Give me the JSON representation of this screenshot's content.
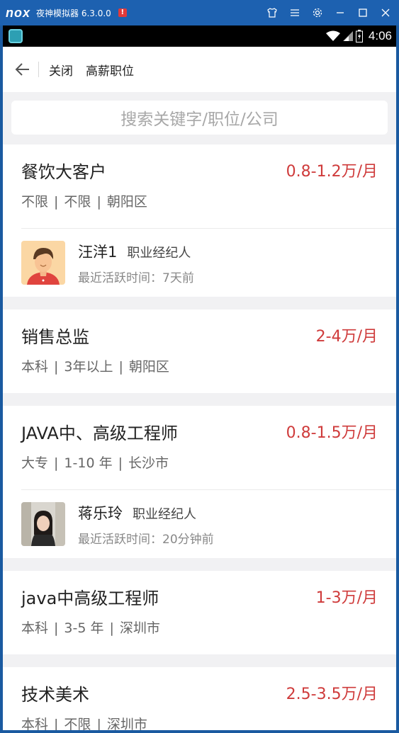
{
  "emulator": {
    "logo": "nox",
    "title": "夜神模拟器 6.3.0.0",
    "alert": "!"
  },
  "status_bar": {
    "time": "4:06"
  },
  "header": {
    "close_label": "关闭",
    "title": "高薪职位"
  },
  "search": {
    "placeholder": "搜索关键字/职位/公司"
  },
  "jobs": [
    {
      "title": "餐饮大客户",
      "salary": "0.8-1.2万/月",
      "education": "不限",
      "experience": "不限",
      "location": "朝阳区",
      "agent": {
        "name": "汪洋1",
        "role": "职业经纪人",
        "active": "最近活跃时间：7天前"
      }
    },
    {
      "title": "销售总监",
      "salary": "2-4万/月",
      "education": "本科",
      "experience": "3年以上",
      "location": "朝阳区"
    },
    {
      "title": "JAVA中、高级工程师",
      "salary": "0.8-1.5万/月",
      "education": "大专",
      "experience": "1-10 年",
      "location": "长沙市",
      "agent": {
        "name": "蒋乐玲",
        "role": "职业经纪人",
        "active": "最近活跃时间：20分钟前"
      }
    },
    {
      "title": "java中高级工程师",
      "salary": "1-3万/月",
      "education": "本科",
      "experience": "3-5 年",
      "location": "深圳市"
    },
    {
      "title": "技术美术",
      "salary": "2.5-3.5万/月",
      "education": "本科",
      "experience": "不限",
      "location": "深圳市"
    }
  ],
  "colors": {
    "salary": "#cf3b3b",
    "emulator_bar": "#1d61b0"
  }
}
